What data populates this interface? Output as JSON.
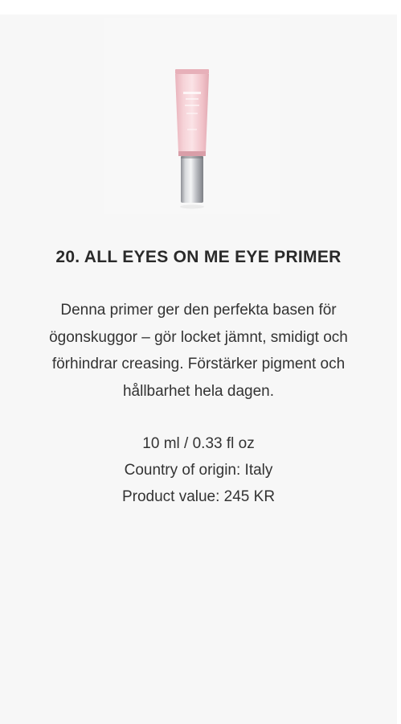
{
  "product": {
    "image_icon": "pink-primer-tube-icon",
    "title": "20. ALL EYES ON ME EYE PRIMER",
    "description": "Denna primer ger den perfekta basen för ögonskuggor – gör locket jämnt, smidigt och förhindrar creasing. Förstärker pigment och hållbarhet hela dagen.",
    "size": "10 ml / 0.33 fl oz",
    "origin": "Country of origin: Italy",
    "value": "Product value: 245 KR"
  },
  "colors": {
    "card_background": "#f7f7f7",
    "tube_pink": "#f2c9cf",
    "cap_silver": "#c9cbcf",
    "text": "#333333"
  }
}
